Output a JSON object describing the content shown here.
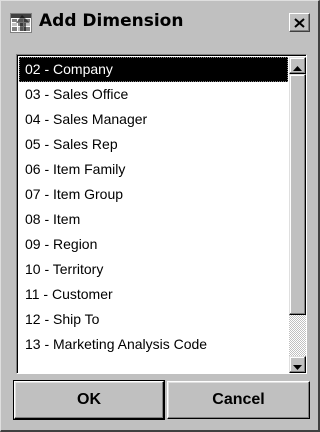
{
  "window": {
    "title": "Add Dimension",
    "icon": "dimension-table-icon",
    "close_icon": "close-icon"
  },
  "list": {
    "items": [
      {
        "label": "02 - Company",
        "selected": true
      },
      {
        "label": "03 - Sales Office",
        "selected": false
      },
      {
        "label": "04 - Sales Manager",
        "selected": false
      },
      {
        "label": "05 - Sales Rep",
        "selected": false
      },
      {
        "label": "06 - Item Family",
        "selected": false
      },
      {
        "label": "07 - Item Group",
        "selected": false
      },
      {
        "label": "08 - Item",
        "selected": false
      },
      {
        "label": "09 - Region",
        "selected": false
      },
      {
        "label": "10 - Territory",
        "selected": false
      },
      {
        "label": "11 - Customer",
        "selected": false
      },
      {
        "label": "12 - Ship To",
        "selected": false
      },
      {
        "label": "13 - Marketing Analysis Code",
        "selected": false
      }
    ]
  },
  "buttons": {
    "ok_label": "OK",
    "cancel_label": "Cancel"
  },
  "colors": {
    "face": "#c0c0c0",
    "selection_bg": "#000000",
    "selection_fg": "#ffffff"
  }
}
